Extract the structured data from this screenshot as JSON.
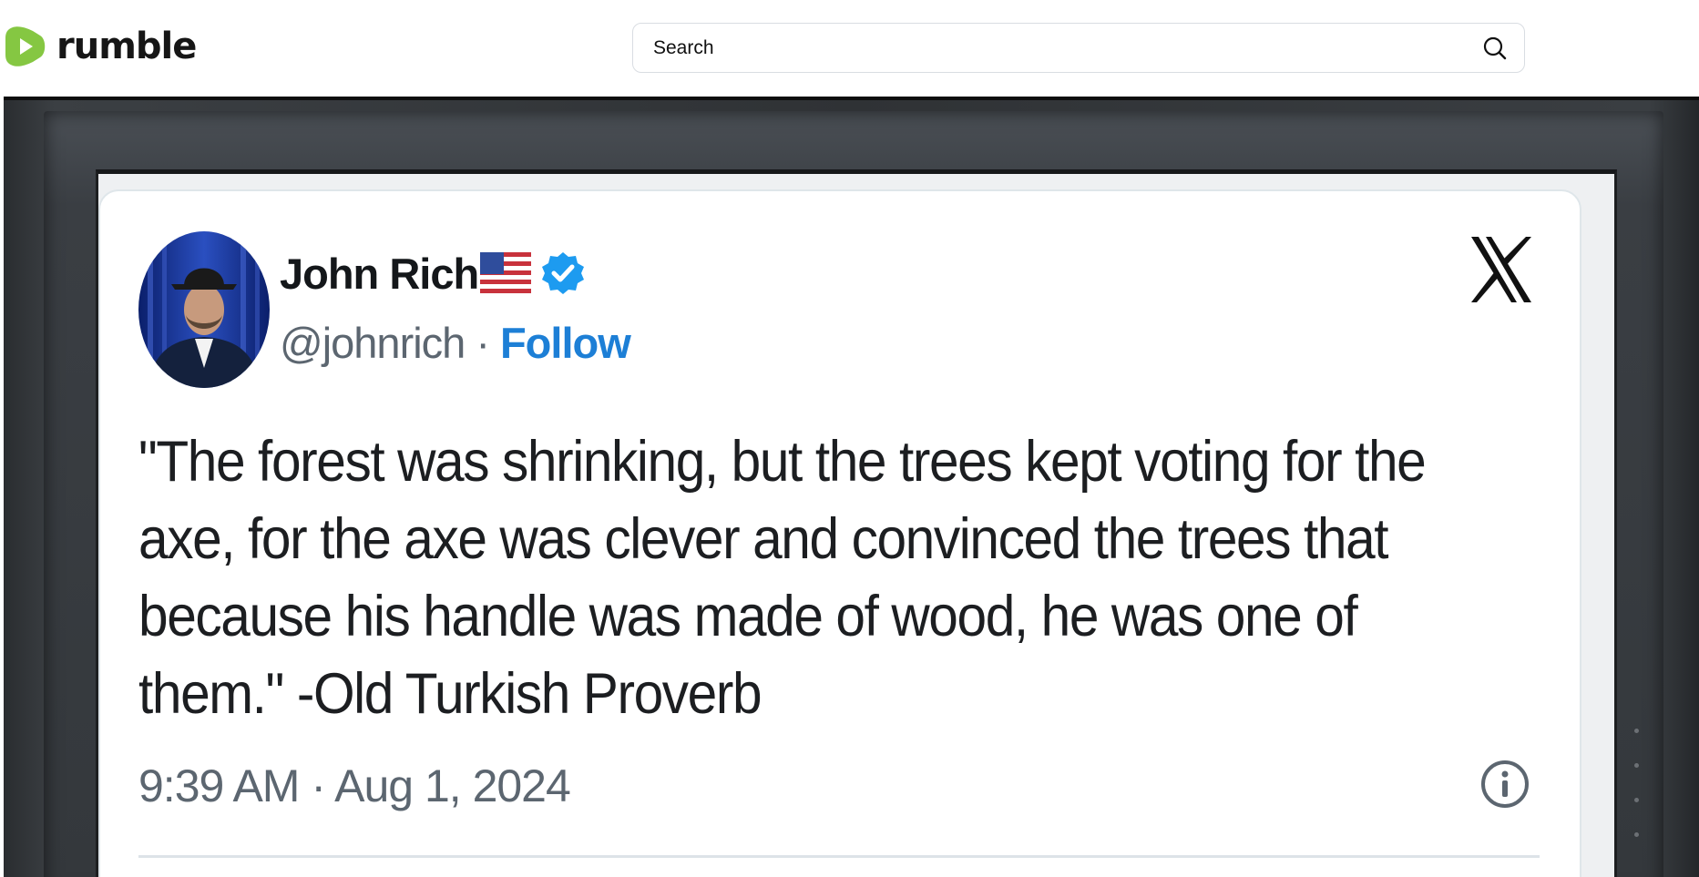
{
  "header": {
    "logo_text": "rumble",
    "search": {
      "placeholder": "Search"
    }
  },
  "tweet": {
    "author_name": "John Rich",
    "handle": "@johnrich",
    "separator": "·",
    "follow_label": "Follow",
    "text": "\"The forest was shrinking, but the trees kept voting for the axe, for the axe was clever and convinced the trees that because his handle was made of wood, he was one of them.\" -Old Turkish Proverb",
    "timestamp": "9:39 AM · Aug 1, 2024",
    "platform_logo": "X"
  },
  "colors": {
    "brand_green": "#85c742",
    "follow_blue": "#1d7fd6",
    "verified_blue": "#1d9bf0"
  },
  "icons": {
    "logo": "rumble-play-icon",
    "search": "search-icon",
    "flag": "us-flag-icon",
    "verified": "verified-badge-icon",
    "platform": "x-logo-icon",
    "info": "info-icon"
  }
}
